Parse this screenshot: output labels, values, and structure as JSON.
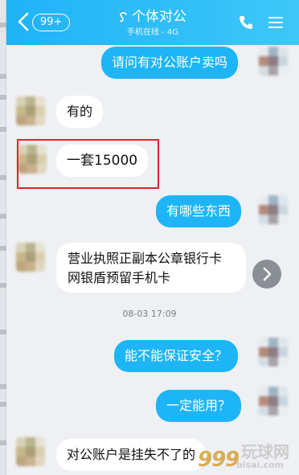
{
  "header": {
    "back_badge": "99+",
    "title": "个体对公",
    "status": "手机在线 - 4G"
  },
  "messages": [
    {
      "dir": "out",
      "text": "请问有对公账户卖吗"
    },
    {
      "dir": "in",
      "text": "有的"
    },
    {
      "dir": "in",
      "text": "一套15000"
    },
    {
      "dir": "out",
      "text": "有哪些东西"
    },
    {
      "dir": "in",
      "lines": [
        "营业执照正副本公章银行卡",
        "网银盾预留手机卡"
      ]
    },
    {
      "dir": "out",
      "text": "能不能保证安全？"
    },
    {
      "dir": "out",
      "text": "一定能用？"
    },
    {
      "dir": "in",
      "text": "对公账户是挂失不了的"
    }
  ],
  "timestamp": "08-03 17:09",
  "watermark": {
    "logo": "999",
    "text": "玩球网",
    "sub": "bisai.com"
  },
  "colors": {
    "header_start": "#1fb3f7",
    "header_end": "#3ec7f8",
    "outgoing_bubble": "#1eb5f6",
    "incoming_bubble": "#ffffff",
    "highlight_border": "#e0232a",
    "background": "#eef0f3"
  },
  "icons": {
    "back": "chevron-left-icon",
    "title_glyph": "ear-icon",
    "call": "phone-icon",
    "menu": "menu-icon",
    "more": "chevron-right-icon"
  }
}
